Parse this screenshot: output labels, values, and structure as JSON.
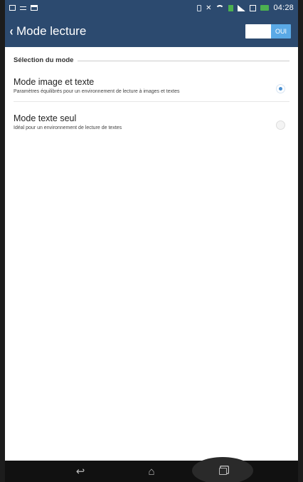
{
  "status_bar": {
    "time": "04:28",
    "left_icons": [
      "gallery-icon",
      "equals-icon",
      "window-icon"
    ],
    "right_icons": [
      "vibrate-icon",
      "mute-icon",
      "wifi-icon",
      "sim-icon",
      "signal-icon",
      "sd-card-icon",
      "battery-icon"
    ]
  },
  "header": {
    "back_icon": "‹",
    "title": "Mode lecture",
    "toggle_label": "OUI",
    "toggle_on": true
  },
  "section": {
    "title": "Sélection du mode"
  },
  "options": [
    {
      "title": "Mode image et texte",
      "description": "Paramètres équilibrés pour un environnement de lecture à images et textes",
      "selected": true
    },
    {
      "title": "Mode texte seul",
      "description": "Idéal pour un environnement de lecture de textes",
      "selected": false
    }
  ],
  "nav": {
    "back": "↩",
    "home": "⌂",
    "recents": "recents-icon"
  },
  "colors": {
    "bar": "#2c4a6f",
    "accent": "#4a8fd0",
    "toggle_on": "#5aa9e6"
  }
}
